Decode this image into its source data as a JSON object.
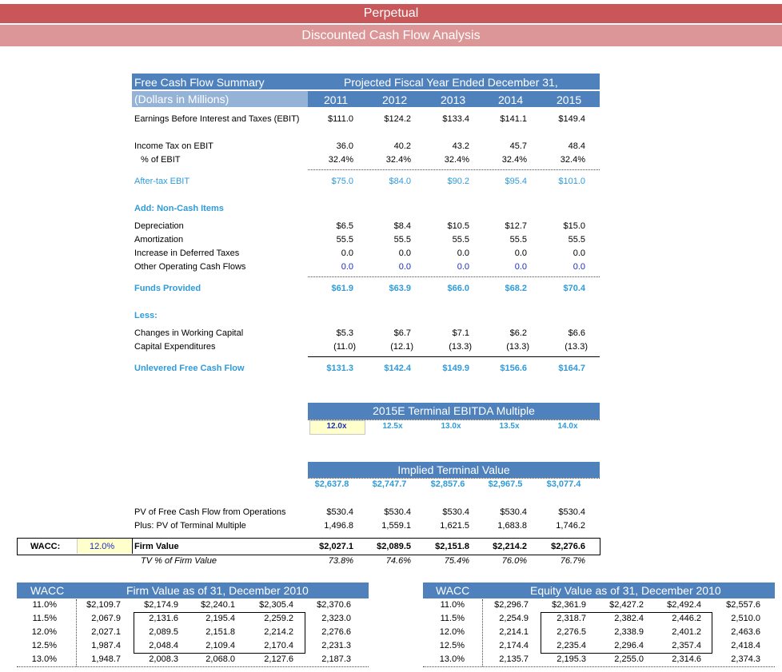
{
  "title": "Perpetual",
  "subtitle": "Discounted Cash Flow Analysis",
  "summary": {
    "heading": "Free Cash Flow Summary",
    "units": "(Dollars in Millions)",
    "period_heading": "Projected Fiscal Year Ended December 31,",
    "years": [
      "2011",
      "2012",
      "2013",
      "2014",
      "2015"
    ],
    "rows": {
      "ebit": {
        "label": "Earnings Before Interest and Taxes (EBIT)",
        "values": [
          "$111.0",
          "$124.2",
          "$133.4",
          "$141.1",
          "$149.4"
        ]
      },
      "tax": {
        "label": "Income Tax on EBIT",
        "values": [
          "36.0",
          "40.2",
          "43.2",
          "45.7",
          "48.4"
        ]
      },
      "tax_pct": {
        "label": "% of EBIT",
        "values": [
          "32.4%",
          "32.4%",
          "32.4%",
          "32.4%",
          "32.4%"
        ]
      },
      "after_tax": {
        "label": "After-tax EBIT",
        "values": [
          "$75.0",
          "$84.0",
          "$90.2",
          "$95.4",
          "$101.0"
        ]
      },
      "add_heading": "Add: Non-Cash Items",
      "dep": {
        "label": "Depreciation",
        "values": [
          "$6.5",
          "$8.4",
          "$10.5",
          "$12.7",
          "$15.0"
        ]
      },
      "amort": {
        "label": "Amortization",
        "values": [
          "55.5",
          "55.5",
          "55.5",
          "55.5",
          "55.5"
        ]
      },
      "def_tax": {
        "label": "Increase in Deferred Taxes",
        "values": [
          "0.0",
          "0.0",
          "0.0",
          "0.0",
          "0.0"
        ]
      },
      "other_ocf": {
        "label": "Other Operating Cash Flows",
        "values": [
          "0.0",
          "0.0",
          "0.0",
          "0.0",
          "0.0"
        ]
      },
      "funds": {
        "label": "Funds Provided",
        "values": [
          "$61.9",
          "$63.9",
          "$66.0",
          "$68.2",
          "$70.4"
        ]
      },
      "less_heading": "Less:",
      "wc": {
        "label": "Changes in Working Capital",
        "values": [
          "$5.3",
          "$6.7",
          "$7.1",
          "$6.2",
          "$6.6"
        ]
      },
      "capex": {
        "label": "Capital Expenditures",
        "values": [
          "(11.0)",
          "(12.1)",
          "(13.3)",
          "(13.3)",
          "(13.3)"
        ]
      },
      "ufcf": {
        "label": "Unlevered Free Cash Flow",
        "values": [
          "$131.3",
          "$142.4",
          "$149.9",
          "$156.6",
          "$164.7"
        ]
      }
    }
  },
  "terminal_multiple": {
    "heading": "2015E Terminal EBITDA Multiple",
    "values": [
      "12.0x",
      "12.5x",
      "13.0x",
      "13.5x",
      "14.0x"
    ]
  },
  "terminal_value": {
    "heading": "Implied Terminal Value",
    "values": [
      "$2,637.8",
      "$2,747.7",
      "$2,857.6",
      "$2,967.5",
      "$3,077.4"
    ]
  },
  "valuation": {
    "pv_fcf": {
      "label": "PV of Free Cash Flow from Operations",
      "values": [
        "$530.4",
        "$530.4",
        "$530.4",
        "$530.4",
        "$530.4"
      ]
    },
    "pv_tv": {
      "label": "Plus:  PV of Terminal Multiple",
      "values": [
        "1,496.8",
        "1,559.1",
        "1,621.5",
        "1,683.8",
        "1,746.2"
      ]
    },
    "firm_value": {
      "label": "Firm Value",
      "values": [
        "$2,027.1",
        "$2,089.5",
        "$2,151.8",
        "$2,214.2",
        "$2,276.6"
      ]
    },
    "tv_pct": {
      "label": "TV % of Firm Value",
      "values": [
        "73.8%",
        "74.6%",
        "75.4%",
        "76.0%",
        "76.7%"
      ]
    },
    "wacc_label": "WACC:",
    "wacc_value": "12.0%"
  },
  "firm_sens": {
    "col_head": "WACC",
    "heading": "Firm Value as of 31, December 2010",
    "rows": [
      {
        "wacc": "11.0%",
        "values": [
          "$2,109.7",
          "$2,174.9",
          "$2,240.1",
          "$2,305.4",
          "$2,370.6"
        ]
      },
      {
        "wacc": "11.5%",
        "values": [
          "2,067.9",
          "2,131.6",
          "2,195.4",
          "2,259.2",
          "2,323.0"
        ]
      },
      {
        "wacc": "12.0%",
        "values": [
          "2,027.1",
          "2,089.5",
          "2,151.8",
          "2,214.2",
          "2,276.6"
        ]
      },
      {
        "wacc": "12.5%",
        "values": [
          "1,987.4",
          "2,048.4",
          "2,109.4",
          "2,170.4",
          "2,231.3"
        ]
      },
      {
        "wacc": "13.0%",
        "values": [
          "1,948.7",
          "2,008.3",
          "2,068.0",
          "2,127.6",
          "2,187.3"
        ]
      }
    ]
  },
  "equity_sens": {
    "col_head": "WACC",
    "heading": "Equity Value as of 31, December 2010",
    "rows": [
      {
        "wacc": "11.0%",
        "values": [
          "$2,296.7",
          "$2,361.9",
          "$2,427.2",
          "$2,492.4",
          "$2,557.6"
        ]
      },
      {
        "wacc": "11.5%",
        "values": [
          "2,254.9",
          "2,318.7",
          "2,382.4",
          "2,446.2",
          "2,510.0"
        ]
      },
      {
        "wacc": "12.0%",
        "values": [
          "2,214.1",
          "2,276.5",
          "2,338.9",
          "2,401.2",
          "2,463.6"
        ]
      },
      {
        "wacc": "12.5%",
        "values": [
          "2,174.4",
          "2,235.4",
          "2,296.4",
          "2,357.4",
          "2,418.4"
        ]
      },
      {
        "wacc": "13.0%",
        "values": [
          "2,135.7",
          "2,195.3",
          "2,255.0",
          "2,314.6",
          "2,374.3"
        ]
      }
    ]
  },
  "colors": {
    "title_bar": "#c9575a",
    "subtitle_bar": "#dd9697",
    "header_blue": "#4f81bd",
    "header_light": "#95b3d7",
    "accent_text": "#2f9bd8",
    "input_blue": "#1a2fbf",
    "input_fill": "#ffffcc"
  }
}
